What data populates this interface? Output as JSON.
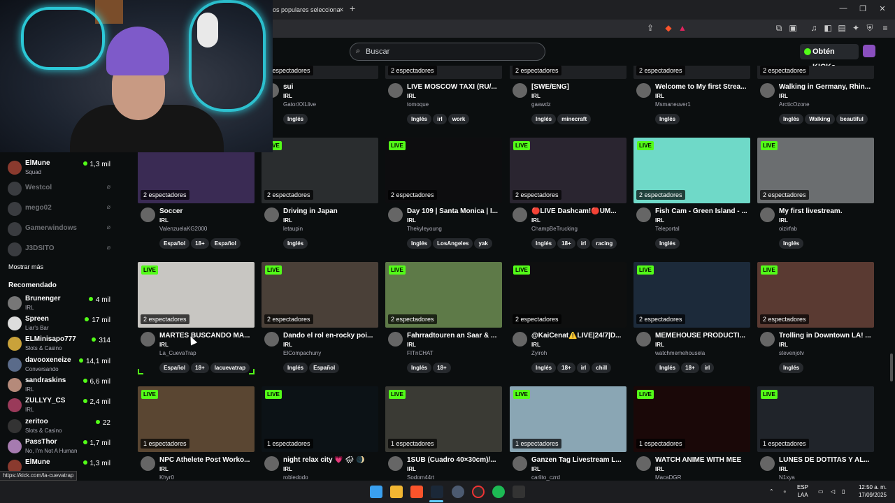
{
  "browser": {
    "tab_title": "ideos populares selecciona",
    "new_tab": "+",
    "window_controls": [
      "—",
      "❐",
      "✕"
    ]
  },
  "header": {
    "search_placeholder": "Buscar",
    "kicks_button": "Obtén KICKs"
  },
  "sidebar": {
    "followed": [
      {
        "name": "ElMune",
        "category": "Squad",
        "viewers": "1,3 mil",
        "live": true
      },
      {
        "name": "Westcol",
        "category": "",
        "viewers": "",
        "live": false
      },
      {
        "name": "mego02",
        "category": "",
        "viewers": "",
        "live": false
      },
      {
        "name": "Gamerwindows",
        "category": "",
        "viewers": "",
        "live": false
      },
      {
        "name": "J3DSITO",
        "category": "",
        "viewers": "",
        "live": false
      }
    ],
    "show_more": "Mostrar más",
    "recommended_title": "Recomendado",
    "recommended": [
      {
        "name": "Brunenger",
        "category": "IRL",
        "viewers": "4 mil"
      },
      {
        "name": "Spreen",
        "category": "Liar's Bar",
        "viewers": "17 mil"
      },
      {
        "name": "ELMinisapo777",
        "category": "Slots & Casino",
        "viewers": "314"
      },
      {
        "name": "davooxeneize",
        "category": "Conversando",
        "viewers": "14,1 mil"
      },
      {
        "name": "sandraskins",
        "category": "IRL",
        "viewers": "6,6 mil"
      },
      {
        "name": "ZULLYY_CS",
        "category": "IRL",
        "viewers": "2,4 mil"
      },
      {
        "name": "zeritoo",
        "category": "Slots & Casino",
        "viewers": "22"
      },
      {
        "name": "PassThor",
        "category": "No, I'm Not A Human",
        "viewers": "1,7 mil"
      },
      {
        "name": "ElMune",
        "category": "",
        "viewers": "1,3 mil"
      }
    ]
  },
  "grid": {
    "row0": [
      {
        "viewers": "2 espectadores",
        "title": "sui",
        "category": "IRL",
        "channel": "GatorXXLlive",
        "tags": [
          "Inglés"
        ]
      },
      {
        "viewers": "2 espectadores",
        "title": "LIVE MOSCOW TAXI (RU/...",
        "category": "IRL",
        "channel": "tomoque",
        "tags": [
          "Inglés",
          "irl",
          "work"
        ]
      },
      {
        "viewers": "2 espectadores",
        "title": "[SWE/ENG]",
        "category": "IRL",
        "channel": "gaawdz",
        "tags": [
          "Inglés",
          "minecraft"
        ]
      },
      {
        "viewers": "2 espectadores",
        "title": "Welcome to My first Strea...",
        "category": "IRL",
        "channel": "Msmaneuver1",
        "tags": [
          "Inglés"
        ]
      },
      {
        "viewers": "2 espectadores",
        "title": "Walking in Germany, Rhin...",
        "category": "IRL",
        "channel": "ArcticOzone",
        "tags": [
          "Inglés",
          "Walking",
          "beautiful"
        ]
      }
    ],
    "row1": [
      {
        "live": "",
        "viewers": "2 espectadores",
        "title": "Soccer",
        "category": "IRL",
        "channel": "ValenzuelaKG2000",
        "tags": [
          "Español",
          "18+",
          "Español"
        ]
      },
      {
        "live": "LIVE",
        "viewers": "2 espectadores",
        "title": "Driving in Japan",
        "category": "IRL",
        "channel": "letaupin",
        "tags": [
          "Inglés"
        ]
      },
      {
        "live": "LIVE",
        "viewers": "2 espectadores",
        "title": "Day 109 | Santa Monica | I...",
        "category": "IRL",
        "channel": "Thekyleyoung",
        "tags": [
          "Inglés",
          "LosAngeles",
          "yak"
        ]
      },
      {
        "live": "LIVE",
        "viewers": "2 espectadores",
        "title": "🔴LIVE Dashcam!🔴UM...",
        "category": "IRL",
        "channel": "ChampBeTrucking",
        "tags": [
          "Inglés",
          "18+",
          "irl",
          "racing"
        ]
      },
      {
        "live": "LIVE",
        "viewers": "2 espectadores",
        "title": "Fish Cam - Green Island - ...",
        "category": "IRL",
        "channel": "Teleportal",
        "tags": [
          "Inglés"
        ]
      },
      {
        "live": "LIVE",
        "viewers": "2 espectadores",
        "title": "My first livestream.",
        "category": "IRL",
        "channel": "oizirfab",
        "tags": [
          "Inglés"
        ]
      }
    ],
    "row2": [
      {
        "live": "LIVE",
        "viewers": "2 espectadores",
        "title": "MARTES BUSCANDO MA...",
        "category": "IRL",
        "channel": "La_CuevaTrap",
        "tags": [
          "Español",
          "18+",
          "lacuevatrap"
        ]
      },
      {
        "live": "LIVE",
        "viewers": "2 espectadores",
        "title": "Dando el rol en-rocky poi...",
        "category": "IRL",
        "channel": "ElCompachuny",
        "tags": [
          "Inglés",
          "Español"
        ]
      },
      {
        "live": "LIVE",
        "viewers": "2 espectadores",
        "title": "Fahrradtouren an Saar & ...",
        "category": "IRL",
        "channel": "FITnCHAT",
        "tags": [
          "Inglés",
          "18+"
        ]
      },
      {
        "live": "LIVE",
        "viewers": "2 espectadores",
        "title": "@KaiCenat⚠️LIVE|24/7|D...",
        "category": "IRL",
        "channel": "Zyiroh",
        "tags": [
          "Inglés",
          "18+",
          "irl",
          "chill"
        ]
      },
      {
        "live": "LIVE",
        "viewers": "2 espectadores",
        "title": "MEMEHOUSE PRODUCTI...",
        "category": "IRL",
        "channel": "watchmemehousela",
        "tags": [
          "Inglés",
          "18+",
          "irl"
        ]
      },
      {
        "live": "LIVE",
        "viewers": "2 espectadores",
        "title": "Trolling in Downtown LA! ...",
        "category": "IRL",
        "channel": "stevenjotv",
        "tags": [
          "Inglés"
        ]
      }
    ],
    "row3": [
      {
        "live": "LIVE",
        "viewers": "1 espectadores",
        "title": "NPC Athelete Post Worko...",
        "category": "IRL",
        "channel": "Khyr0",
        "tags": []
      },
      {
        "live": "LIVE",
        "viewers": "1 espectadores",
        "title": "night relax city 💗 🌧 🌒",
        "category": "IRL",
        "channel": "robledodo",
        "tags": []
      },
      {
        "live": "LIVE",
        "viewers": "1 espectadores",
        "title": "1SUB (Cuadro 40×30cm)/...",
        "category": "IRL",
        "channel": "Sodom44rt",
        "tags": []
      },
      {
        "live": "LIVE",
        "viewers": "1 espectadores",
        "title": "Ganzen Tag Livestream L...",
        "category": "IRL",
        "channel": "carlito_czrd",
        "tags": []
      },
      {
        "live": "LIVE",
        "viewers": "1 espectadores",
        "title": "WATCH ANIME WITH MEE",
        "category": "IRL",
        "channel": "MacaDGR",
        "tags": []
      },
      {
        "live": "LIVE",
        "viewers": "1 espectadores",
        "title": "LUNES DE DOTITAS Y AL...",
        "category": "IRL",
        "channel": "N1xya",
        "tags": []
      }
    ]
  },
  "status_url": "https://kick.com/la-cuevatrap",
  "taskbar": {
    "lang": "ESP",
    "lang2": "LAA",
    "time": "12:50 a. m.",
    "date": "17/09/2025"
  },
  "colors": {
    "accent": "#53fc18",
    "bg": "#0b0e0f",
    "tag_bg": "#26292d"
  }
}
